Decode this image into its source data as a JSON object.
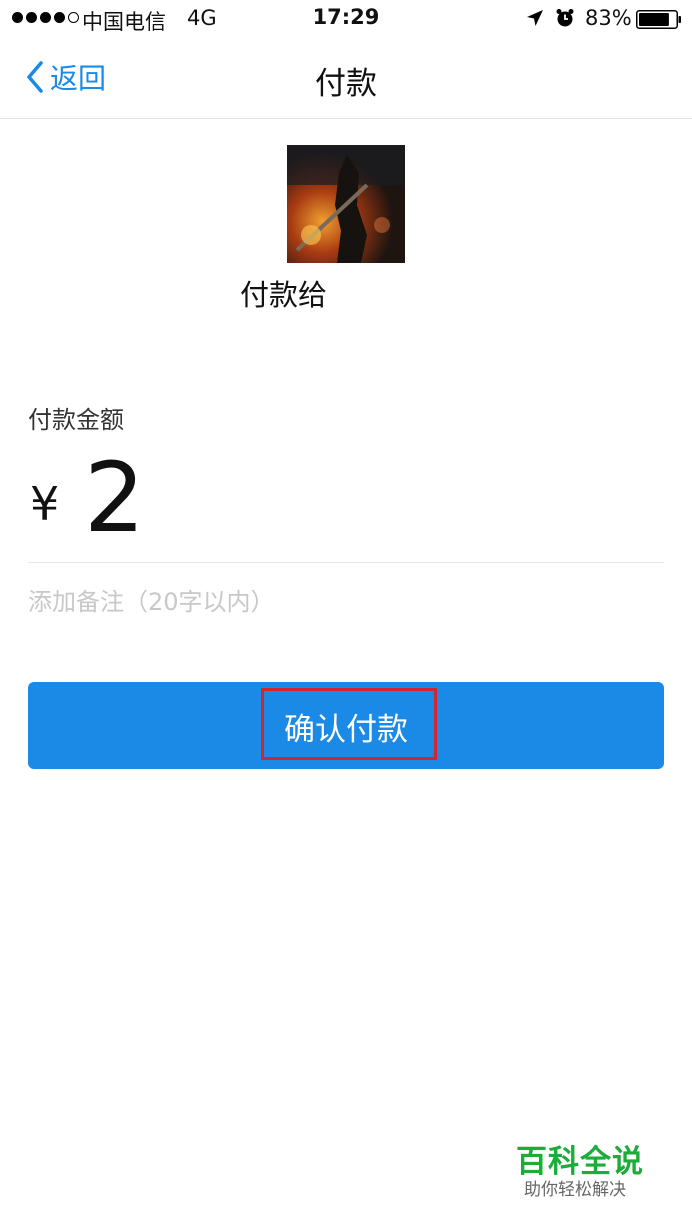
{
  "status_bar": {
    "carrier": "中国电信",
    "network": "4G",
    "time": "17:29",
    "battery": "83%",
    "battery_level": 0.83
  },
  "nav": {
    "back_label": "返回",
    "title": "付款"
  },
  "payee": {
    "label": "付款给"
  },
  "amount": {
    "label": "付款金额",
    "currency": "¥",
    "value": "2"
  },
  "remark": {
    "placeholder": "添加备注（20字以内）",
    "value": ""
  },
  "confirm": {
    "label": "确认付款"
  },
  "watermark": {
    "title": "百科全说",
    "subtitle": "助你轻松解决"
  },
  "colors": {
    "accent": "#1a8ae6",
    "highlight": "#d0262f",
    "watermark": "#1aad3a"
  }
}
